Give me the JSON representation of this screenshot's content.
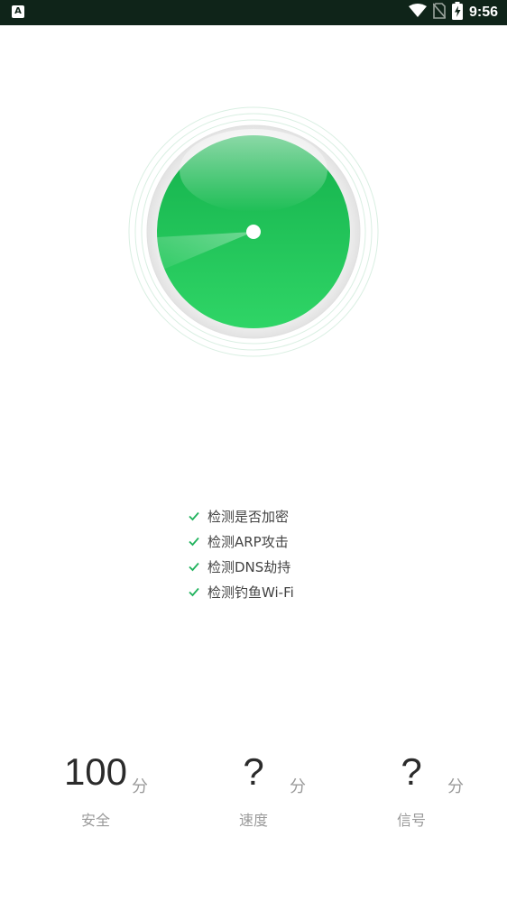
{
  "status_bar": {
    "left_icon_letter": "A",
    "time": "9:56",
    "icons": [
      "wifi-icon",
      "no-sim-icon",
      "battery-charging-icon"
    ]
  },
  "scanner": {
    "colors": {
      "outer_green": "#14b14c",
      "inner_green": "#2fd566",
      "ring_line": "#d9efe2",
      "center_dot": "#ffffff"
    }
  },
  "checks": {
    "icon": "check-icon",
    "check_color": "#22b35e",
    "items": [
      {
        "label": "检测是否加密"
      },
      {
        "label": "检测ARP攻击"
      },
      {
        "label": "检测DNS劫持"
      },
      {
        "label": "检测钓鱼Wi-Fi"
      }
    ]
  },
  "scores": {
    "unit": "分",
    "items": [
      {
        "value": "100",
        "label": "安全"
      },
      {
        "value": "?",
        "label": "速度"
      },
      {
        "value": "?",
        "label": "信号"
      }
    ]
  }
}
